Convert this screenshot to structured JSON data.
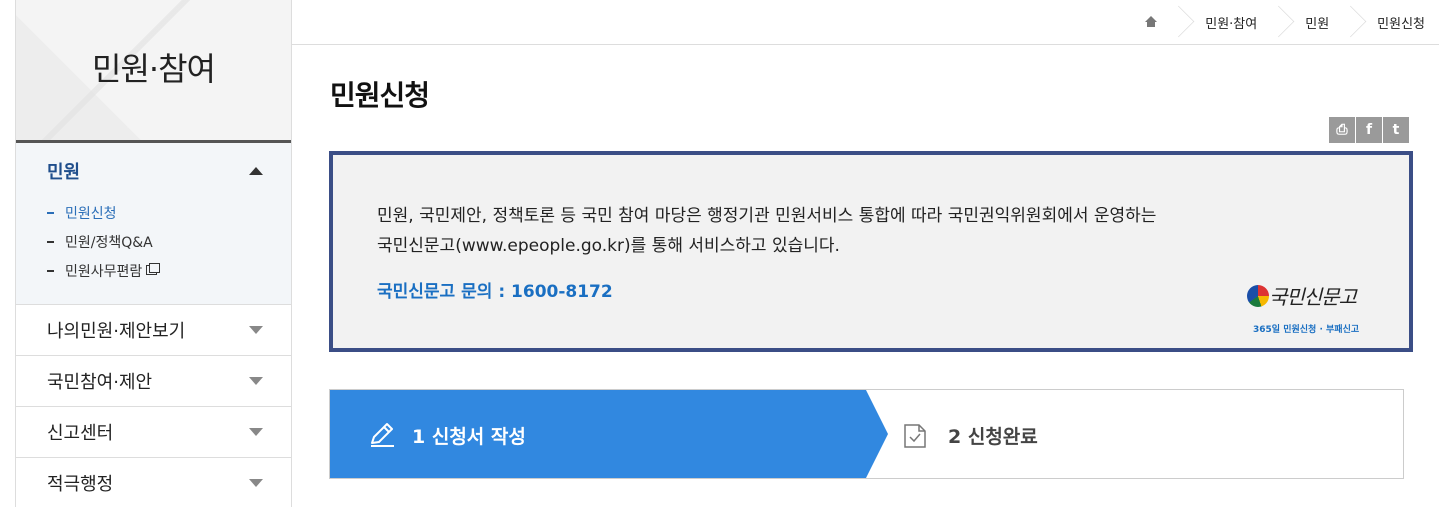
{
  "sidebar": {
    "title": "민원·참여",
    "active_group": {
      "label": "민원",
      "items": [
        {
          "label": "민원신청",
          "active": true
        },
        {
          "label": "민원/정책Q&A",
          "active": false
        },
        {
          "label": "민원사무편람",
          "active": false,
          "icon": "new-window-icon"
        }
      ]
    },
    "groups": [
      {
        "label": "나의민원·제안보기"
      },
      {
        "label": "국민참여·제안"
      },
      {
        "label": "신고센터"
      },
      {
        "label": "적극행정"
      }
    ]
  },
  "breadcrumb": {
    "home_icon": "home-icon",
    "items": [
      "민원·참여",
      "민원",
      "민원신청"
    ]
  },
  "page": {
    "title": "민원신청"
  },
  "share": {
    "buttons": [
      {
        "icon": "print-icon",
        "glyph": "⎙"
      },
      {
        "icon": "facebook-icon",
        "glyph": "f"
      },
      {
        "icon": "twitter-icon",
        "glyph": "t"
      }
    ]
  },
  "notice": {
    "line1": "민원, 국민제안, 정책토론 등 국민 참여 마당은 행정기관 민원서비스 통합에 따라 국민권익위원회에서 운영하는",
    "line2": "국민신문고(www.epeople.go.kr)를 통해 서비스하고 있습니다.",
    "contact": "국민신문고 문의 : 1600-8172",
    "logo_text": "국민신문고",
    "logo_sub": "365일 민원신청 · 부패신고"
  },
  "steps": [
    {
      "label": "1 신청서 작성",
      "icon": "pencil-icon",
      "active": true
    },
    {
      "label": "2 신청완료",
      "icon": "document-check-icon",
      "active": false
    }
  ],
  "colors": {
    "accent": "#3188e0",
    "border_navy": "#3b4e86",
    "link_blue": "#1a6fc2",
    "active_menu": "#1f4e8c"
  }
}
